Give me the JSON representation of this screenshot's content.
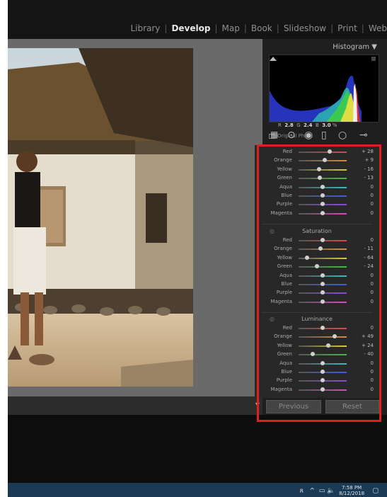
{
  "modules": [
    "Library",
    "Develop",
    "Map",
    "Book",
    "Slideshow",
    "Print",
    "Web"
  ],
  "active_module": "Develop",
  "histogram": {
    "title": "Histogram",
    "r_label": "R",
    "r_value": "2.8",
    "g_label": "G",
    "g_value": "2.4",
    "b_label": "B",
    "b_value": "3.0",
    "unit": "%",
    "original_photo_label": "Original Photo"
  },
  "hsl": {
    "hue_rows": [
      {
        "name": "Red",
        "value": "+ 28",
        "level": 0.64,
        "color": "#d94a4a"
      },
      {
        "name": "Orange",
        "value": "+ 9",
        "level": 0.55,
        "color": "#d98a3a"
      },
      {
        "name": "Yellow",
        "value": "- 16",
        "level": 0.42,
        "color": "#d9c93a"
      },
      {
        "name": "Green",
        "value": "- 13",
        "level": 0.44,
        "color": "#4ab84a"
      },
      {
        "name": "Aqua",
        "value": "0",
        "level": 0.5,
        "color": "#3ab8c0"
      },
      {
        "name": "Blue",
        "value": "0",
        "level": 0.5,
        "color": "#3a5fd9"
      },
      {
        "name": "Purple",
        "value": "0",
        "level": 0.5,
        "color": "#8a4ad9"
      },
      {
        "name": "Magenta",
        "value": "0",
        "level": 0.5,
        "color": "#d94ac0"
      }
    ],
    "saturation": {
      "label": "Saturation",
      "rows": [
        {
          "name": "Red",
          "value": "0",
          "level": 0.5,
          "color": "#d94a4a"
        },
        {
          "name": "Orange",
          "value": "- 11",
          "level": 0.45,
          "color": "#d98a3a"
        },
        {
          "name": "Yellow",
          "value": "- 64",
          "level": 0.18,
          "color": "#d9c93a"
        },
        {
          "name": "Green",
          "value": "- 24",
          "level": 0.38,
          "color": "#4ab84a"
        },
        {
          "name": "Aqua",
          "value": "0",
          "level": 0.5,
          "color": "#3ab8c0"
        },
        {
          "name": "Blue",
          "value": "0",
          "level": 0.5,
          "color": "#3a5fd9"
        },
        {
          "name": "Purple",
          "value": "0",
          "level": 0.5,
          "color": "#8a4ad9"
        },
        {
          "name": "Magenta",
          "value": "0",
          "level": 0.5,
          "color": "#d94ac0"
        }
      ]
    },
    "luminance": {
      "label": "Luminance",
      "rows": [
        {
          "name": "Red",
          "value": "0",
          "level": 0.5,
          "color": "#d94a4a"
        },
        {
          "name": "Orange",
          "value": "+ 49",
          "level": 0.75,
          "color": "#d98a3a"
        },
        {
          "name": "Yellow",
          "value": "+ 24",
          "level": 0.62,
          "color": "#d9c93a"
        },
        {
          "name": "Green",
          "value": "- 40",
          "level": 0.3,
          "color": "#4ab84a"
        },
        {
          "name": "Aqua",
          "value": "0",
          "level": 0.5,
          "color": "#3ab8c0"
        },
        {
          "name": "Blue",
          "value": "0",
          "level": 0.5,
          "color": "#3a5fd9"
        },
        {
          "name": "Purple",
          "value": "0",
          "level": 0.5,
          "color": "#8a4ad9"
        },
        {
          "name": "Magenta",
          "value": "0",
          "level": 0.5,
          "color": "#d94ac0"
        }
      ]
    }
  },
  "buttons": {
    "previous": "Previous",
    "reset": "Reset"
  },
  "taskbar": {
    "time": "7:58 PM",
    "date": "8/12/2018"
  },
  "highlight_color": "#e0201f"
}
